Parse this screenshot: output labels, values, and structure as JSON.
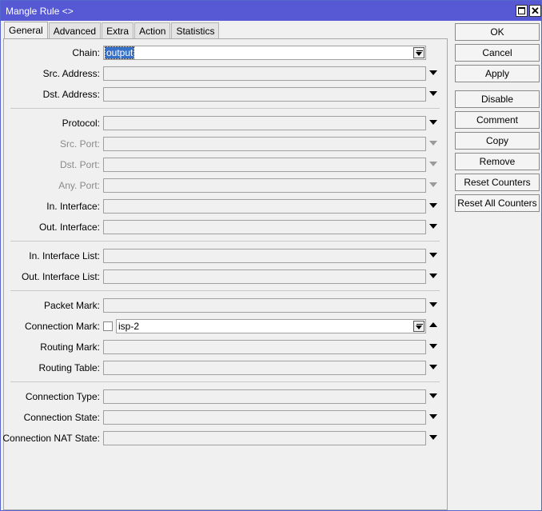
{
  "window": {
    "title": "Mangle Rule <>"
  },
  "tabs": [
    "General",
    "Advanced",
    "Extra",
    "Action",
    "Statistics"
  ],
  "fields": {
    "chain": {
      "label": "Chain:",
      "value": "output"
    },
    "src_address": {
      "label": "Src. Address:",
      "value": ""
    },
    "dst_address": {
      "label": "Dst. Address:",
      "value": ""
    },
    "protocol": {
      "label": "Protocol:",
      "value": ""
    },
    "src_port": {
      "label": "Src. Port:",
      "value": ""
    },
    "dst_port": {
      "label": "Dst. Port:",
      "value": ""
    },
    "any_port": {
      "label": "Any. Port:",
      "value": ""
    },
    "in_interface": {
      "label": "In. Interface:",
      "value": ""
    },
    "out_interface": {
      "label": "Out. Interface:",
      "value": ""
    },
    "in_interface_list": {
      "label": "In. Interface List:",
      "value": ""
    },
    "out_interface_list": {
      "label": "Out. Interface List:",
      "value": ""
    },
    "packet_mark": {
      "label": "Packet Mark:",
      "value": ""
    },
    "connection_mark": {
      "label": "Connection Mark:",
      "value": "isp-2"
    },
    "routing_mark": {
      "label": "Routing Mark:",
      "value": ""
    },
    "routing_table": {
      "label": "Routing Table:",
      "value": ""
    },
    "connection_type": {
      "label": "Connection Type:",
      "value": ""
    },
    "connection_state": {
      "label": "Connection State:",
      "value": ""
    },
    "connection_nat_state": {
      "label": "Connection NAT State:",
      "value": ""
    }
  },
  "buttons": {
    "ok": "OK",
    "cancel": "Cancel",
    "apply": "Apply",
    "disable": "Disable",
    "comment": "Comment",
    "copy": "Copy",
    "remove": "Remove",
    "reset_counters": "Reset Counters",
    "reset_all_counters": "Reset All Counters"
  }
}
